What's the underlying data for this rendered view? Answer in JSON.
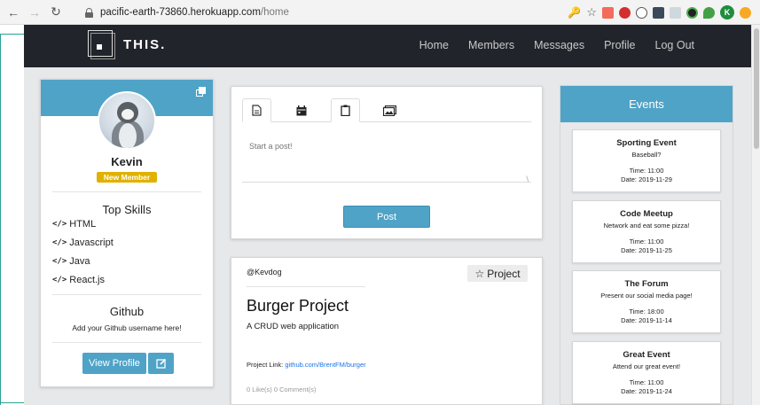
{
  "browser": {
    "url_host": "pacific-earth-73860.herokuapp.com",
    "url_path": "/home",
    "profile_initial": "K"
  },
  "navbar": {
    "brand": "THIS.",
    "links": [
      "Home",
      "Members",
      "Messages",
      "Profile",
      "Log Out"
    ]
  },
  "profile": {
    "name": "Kevin",
    "badge": "New Member",
    "skills_heading": "Top Skills",
    "skills": [
      "HTML",
      "Javascript",
      "Java",
      "React.js"
    ],
    "github_heading": "Github",
    "github_text": "Add your Github username here!",
    "view_profile_label": "View Profile"
  },
  "composer": {
    "placeholder": "Start a post!",
    "post_label": "Post",
    "tabs": [
      "text-tab-icon",
      "calendar-tab-icon",
      "clipboard-tab-icon",
      "image-tab-icon"
    ]
  },
  "post": {
    "author": "@Kevdog",
    "tag": "Project",
    "title": "Burger Project",
    "subtitle": "A CRUD web application",
    "link_label": "Project Link: ",
    "link_text": "github.com/BrentFM/burger",
    "stats": "0 Like(s)    0 Comment(s)"
  },
  "events": {
    "heading": "Events",
    "items": [
      {
        "title": "Sporting Event",
        "description": "Baseball?",
        "time": "Time: 11:00",
        "date": "Date: 2019-11-29"
      },
      {
        "title": "Code Meetup",
        "description": "Network and eat some pizza!",
        "time": "Time: 11:00",
        "date": "Date: 2019-11-25"
      },
      {
        "title": "The Forum",
        "description": "Present our social media page!",
        "time": "Time: 18:00",
        "date": "Date: 2019-11-14"
      },
      {
        "title": "Great Event",
        "description": "Attend our great event!",
        "time": "Time: 11:00",
        "date": "Date: 2019-11-24"
      }
    ]
  },
  "colors": {
    "accent": "#4fa3c7",
    "navbar": "#22242b",
    "badge": "#e0b100",
    "page_bg": "#e6e8ea"
  }
}
